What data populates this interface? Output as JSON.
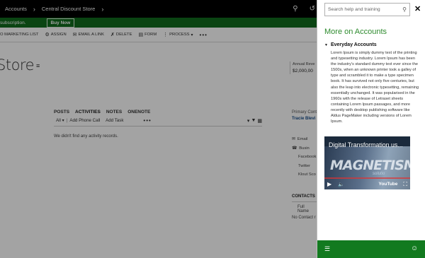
{
  "topnav": {
    "crumbs": [
      "Accounts",
      "Central Discount Store"
    ]
  },
  "notification": {
    "text": "subscription.",
    "buy_button": "Buy Now"
  },
  "commands": [
    {
      "icon": "marketing-list-icon",
      "label": "O MARKETING LIST"
    },
    {
      "icon": "assign-icon",
      "label": "ASSIGN"
    },
    {
      "icon": "email-link-icon",
      "label": "EMAIL A LINK"
    },
    {
      "icon": "delete-icon",
      "label": "DELETE"
    },
    {
      "icon": "form-icon",
      "label": "FORM"
    },
    {
      "icon": "process-icon",
      "label": "PROCESS"
    }
  ],
  "record": {
    "name": "Store"
  },
  "revenue": {
    "label": "Annual Reve",
    "value": "$2,000,00"
  },
  "activity_tabs": [
    "POSTS",
    "ACTIVITIES",
    "NOTES",
    "ONENOTE"
  ],
  "activity_bar": {
    "filter": "All",
    "add_phone_call": "Add Phone Call",
    "add_task": "Add Task",
    "more": "•••"
  },
  "activity_empty": "We didn't find any activity records.",
  "primary_contact": {
    "label": "Primary Conta",
    "name": "Tracie Blevi"
  },
  "channels": [
    "Email",
    "Busin",
    "Facebook",
    "Twitter",
    "Klout Sco"
  ],
  "contacts": {
    "heading": "CONTACTS",
    "column": "Full Name",
    "empty": "No Contact r"
  },
  "help_panel": {
    "search_placeholder": "Search help and training",
    "title": "More on Accounts",
    "section_title": "Everyday Accounts",
    "section_body": "Lorem Ipsum is simply dummy text of the printing and typesetting industry. Lorem Ipsum has been the industry's standard dummy text ever since the 1500s, when an unknown printer took a galley of type and scrambled it to make a type specimen book. It has survived not only five centuries, but also the leap into electronic typesetting, remaining essentially unchanged. It was popularised in the 1960s with the release of Letraset sheets containing Lorem Ipsum passages, and more recently with desktop publishing software like Aldus PageMaker including versions of Lorem Ipsum.",
    "video": {
      "title": "Digital Transformation us...",
      "watermark": "MAGNETISM",
      "watermark_sub": "solutio",
      "provider": "YouTube"
    }
  },
  "colors": {
    "accent_green": "#127a1f",
    "title_green": "#2e8b2e",
    "notification_green": "#106b1d"
  }
}
